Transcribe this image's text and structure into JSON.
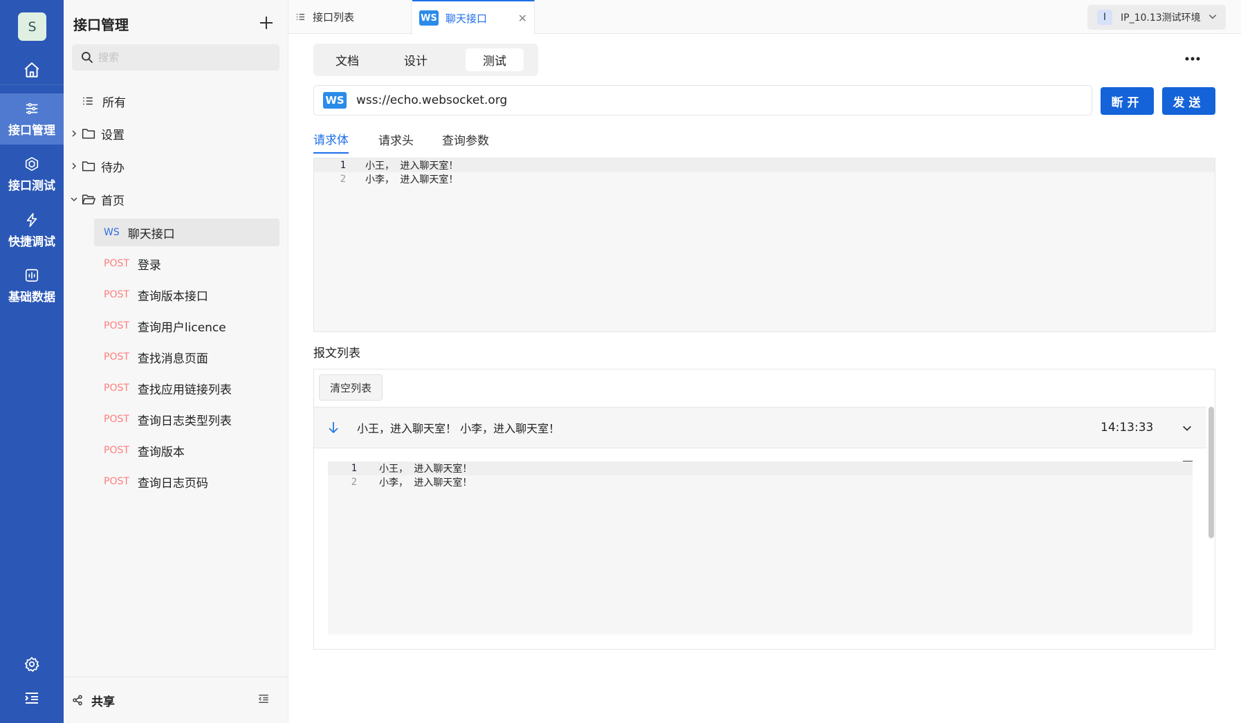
{
  "rail": {
    "avatar": "S",
    "items": [
      {
        "label": "接口管理"
      },
      {
        "label": "接口测试"
      },
      {
        "label": "快捷调试"
      },
      {
        "label": "基础数据"
      }
    ],
    "accent": "#2b58b6",
    "active_bg": "#4f7ad0"
  },
  "sidebar": {
    "title": "接口管理",
    "search_placeholder": "搜索",
    "all_label": "所有",
    "folders": [
      {
        "label": "设置"
      },
      {
        "label": "待办"
      },
      {
        "label": "首页"
      }
    ],
    "apis": [
      {
        "method": "WS",
        "name": "聊天接口"
      },
      {
        "method": "POST",
        "name": "登录"
      },
      {
        "method": "POST",
        "name": "查询版本接口"
      },
      {
        "method": "POST",
        "name": "查询用户licence"
      },
      {
        "method": "POST",
        "name": "查找消息页面"
      },
      {
        "method": "POST",
        "name": "查找应用链接列表"
      },
      {
        "method": "POST",
        "name": "查询日志类型列表"
      },
      {
        "method": "POST",
        "name": "查询版本"
      },
      {
        "method": "POST",
        "name": "查询日志页码"
      }
    ],
    "share_label": "共享"
  },
  "tabs": {
    "list_tab": "接口列表",
    "active_tab_chip": "WS",
    "active_tab": "聊天接口",
    "env_chip": "I",
    "env_label": "IP_10.13测试环境"
  },
  "main": {
    "modes": [
      "文档",
      "设计",
      "测试"
    ],
    "active_mode": "测试",
    "url_chip": "WS",
    "url": "wss://echo.websocket.org",
    "disconnect_label": "断开",
    "send_label": "发送",
    "sub_tabs": [
      "请求体",
      "请求头",
      "查询参数"
    ],
    "body_lines": [
      {
        "n": "1",
        "text": "小王， 进入聊天室！"
      },
      {
        "n": "2",
        "text": "小李， 进入聊天室！"
      }
    ],
    "messages_title": "报文列表",
    "clear_label": "清空列表",
    "message": {
      "text": "小王，进入聊天室！ 小李，进入聊天室！",
      "time": "14:13:33",
      "lines": [
        {
          "n": "1",
          "text": "小王， 进入聊天室！"
        },
        {
          "n": "2",
          "text": "小李， 进入聊天室！"
        }
      ]
    }
  }
}
